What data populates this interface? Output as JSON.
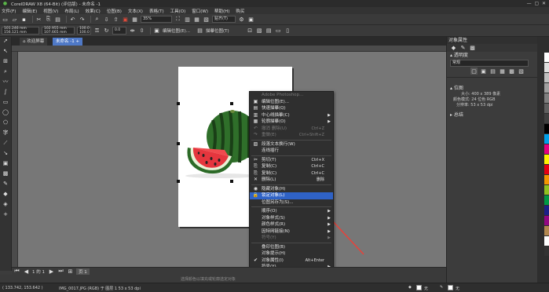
{
  "app": {
    "title": "CorelDRAW X8 (64-Bit) (评估版) - 未命名 -1"
  },
  "menu": [
    "文件(F)",
    "编辑(E)",
    "视图(V)",
    "布局(L)",
    "效果(C)",
    "位图(B)",
    "文本(X)",
    "表格(T)",
    "工具(O)",
    "窗口(W)",
    "帮助(H)",
    "购买"
  ],
  "toolbar1": {
    "zoom": "35%",
    "snap": "贴齐(T)"
  },
  "toolbar2": {
    "x": "101.246 mm",
    "y": "156.121 mm",
    "w": "102.955 mm",
    "h": "107.665 mm",
    "sx": "100.0",
    "sy": "100.0",
    "angle": "0.0",
    "edit_bitmap": "编辑位图(E)...",
    "trace_bitmap": "描摹位图(T)"
  },
  "doc_tabs": {
    "welcome": "欢迎屏幕",
    "doc": "未命名 -1"
  },
  "context_menu": [
    {
      "label": "Adobe Photoshop...",
      "icon": "",
      "shortcut": "",
      "arrow": false,
      "disabled": true
    },
    {
      "label": "编辑位图(E)...",
      "icon": "▣",
      "shortcut": "",
      "arrow": false,
      "disabled": false
    },
    {
      "label": "快速描摹(Q)",
      "icon": "▤",
      "shortcut": "",
      "arrow": false,
      "disabled": false
    },
    {
      "label": "中心线描摹(C)",
      "icon": "▥",
      "shortcut": "",
      "arrow": true,
      "disabled": false
    },
    {
      "label": "轮廓描摹(O)",
      "icon": "▦",
      "shortcut": "",
      "arrow": true,
      "disabled": false
    },
    {
      "label": "撤消 删除(U)",
      "icon": "↶",
      "shortcut": "Ctrl+Z",
      "arrow": false,
      "disabled": true
    },
    {
      "label": "重做(E)",
      "icon": "↷",
      "shortcut": "Ctrl+Shift+Z",
      "arrow": false,
      "disabled": true
    },
    {
      "sep": true
    },
    {
      "label": "段落文本换行(W)",
      "icon": "▨",
      "shortcut": "",
      "arrow": false,
      "disabled": false
    },
    {
      "label": "连线插行",
      "icon": "",
      "shortcut": "",
      "arrow": false,
      "disabled": false
    },
    {
      "sep": true
    },
    {
      "label": "剪切(T)",
      "icon": "✂",
      "shortcut": "Ctrl+X",
      "arrow": false,
      "disabled": false
    },
    {
      "label": "复制(C)",
      "icon": "⎘",
      "shortcut": "Ctrl+C",
      "arrow": false,
      "disabled": false
    },
    {
      "label": "复制(C)",
      "icon": "⎘",
      "shortcut": "Ctrl+C",
      "arrow": false,
      "disabled": false
    },
    {
      "label": "删除(L)",
      "icon": "✕",
      "shortcut": "删除",
      "arrow": false,
      "disabled": false
    },
    {
      "sep": true
    },
    {
      "label": "隐藏对象(H)",
      "icon": "◉",
      "shortcut": "",
      "arrow": false,
      "disabled": false
    },
    {
      "label": "锁定对象(L)",
      "icon": "🔒",
      "shortcut": "",
      "arrow": false,
      "disabled": false,
      "highlight": true
    },
    {
      "label": "位图另存为(S)...",
      "icon": "",
      "shortcut": "",
      "arrow": false,
      "disabled": false
    },
    {
      "sep": true
    },
    {
      "label": "顺序(O)",
      "icon": "",
      "shortcut": "",
      "arrow": true,
      "disabled": false
    },
    {
      "label": "对象样式(S)",
      "icon": "",
      "shortcut": "",
      "arrow": true,
      "disabled": false
    },
    {
      "label": "颜色样式(R)",
      "icon": "",
      "shortcut": "",
      "arrow": true,
      "disabled": false
    },
    {
      "label": "因特网链接(N)",
      "icon": "",
      "shortcut": "",
      "arrow": true,
      "disabled": false
    },
    {
      "label": "符号(Y)",
      "icon": "",
      "shortcut": "",
      "arrow": true,
      "disabled": true
    },
    {
      "sep": true
    },
    {
      "label": "叠印位图(B)",
      "icon": "",
      "shortcut": "",
      "arrow": false,
      "disabled": false
    },
    {
      "label": "对象提示(H)",
      "icon": "",
      "shortcut": "",
      "arrow": false,
      "disabled": false
    },
    {
      "label": "对象属性(I)",
      "icon": "✔",
      "shortcut": "Alt+Enter",
      "arrow": false,
      "disabled": false
    },
    {
      "label": "符号(Y)",
      "icon": "",
      "shortcut": "",
      "arrow": true,
      "disabled": false
    }
  ],
  "page_nav": {
    "page_label": "页 1",
    "counter": "1 的 1"
  },
  "status": {
    "coords": "( 133.742, 153.642 )",
    "info": "IMG_0017.JPG (RGB) 于 图层 1 53 x 53 dpi",
    "hint": "选择颜色以填充或轮廓选定对象"
  },
  "panel": {
    "title": "对象属性",
    "section_transparency": "透明度",
    "blend_mode": "常规",
    "section_bitmap": "位图",
    "size": "大小: 400 x 389 像素",
    "color_mode": "颜色模式: 24 位色 RGB",
    "resolution": "分辨率: 53 x 53 dpi",
    "section_summary": "总结",
    "fill_none": "无",
    "outline_none": "无"
  },
  "colors": {
    "accent": "#2f62c6",
    "arrow": "#e8423a"
  }
}
